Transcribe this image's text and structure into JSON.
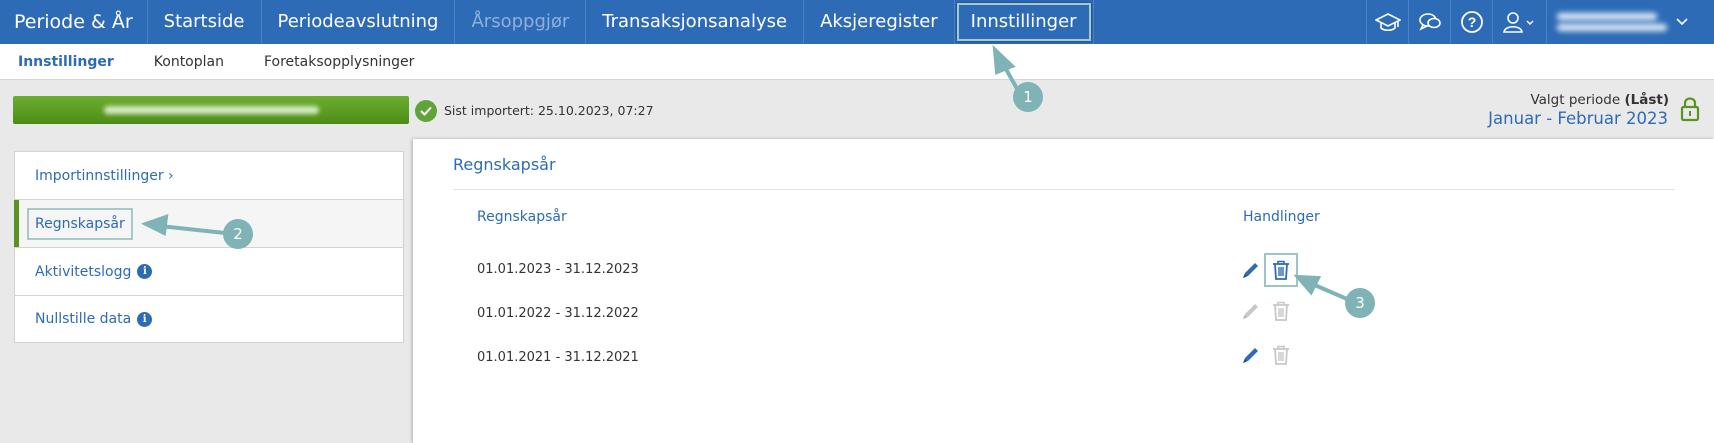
{
  "topbar": {
    "brand": "Periode & År",
    "nav": [
      {
        "label": "Startside",
        "state": "normal"
      },
      {
        "label": "Periodeavslutning",
        "state": "normal"
      },
      {
        "label": "Årsoppgjør",
        "state": "disabled"
      },
      {
        "label": "Transaksjonsanalyse",
        "state": "normal"
      },
      {
        "label": "Aksjeregister",
        "state": "normal"
      },
      {
        "label": "Innstillinger",
        "state": "active"
      }
    ],
    "icons": [
      "graduation-cap-icon",
      "chat-icon",
      "help-icon",
      "user-icon"
    ]
  },
  "subnav": {
    "items": [
      {
        "label": "Innstillinger",
        "active": true
      },
      {
        "label": "Kontoplan",
        "active": false
      },
      {
        "label": "Foretaksopplysninger",
        "active": false
      }
    ]
  },
  "import": {
    "last_imported": "Sist importert: 25.10.2023, 07:27"
  },
  "period": {
    "label": "Valgt periode",
    "locked_label": "(Låst)",
    "value": "Januar - Februar 2023"
  },
  "sidebar": {
    "items": [
      {
        "label": "Importinnstillinger ›",
        "info": false,
        "selected": false
      },
      {
        "label": "Regnskapsår",
        "info": false,
        "selected": true
      },
      {
        "label": "Aktivitetslogg",
        "info": true,
        "selected": false
      },
      {
        "label": "Nullstille data",
        "info": true,
        "selected": false
      }
    ]
  },
  "main": {
    "title": "Regnskapsår",
    "columns": {
      "year": "Regnskapsår",
      "actions": "Handlinger"
    },
    "rows": [
      {
        "period": "01.01.2023 - 31.12.2023",
        "editable": true,
        "deletable": true
      },
      {
        "period": "01.01.2022 - 31.12.2022",
        "editable": false,
        "deletable": false
      },
      {
        "period": "01.01.2021 - 31.12.2021",
        "editable": true,
        "deletable": false
      }
    ]
  },
  "callouts": [
    "1",
    "2",
    "3"
  ],
  "colors": {
    "brand_blue": "#2d6bb6",
    "green": "#5b9320",
    "callout": "#7fb3b6"
  }
}
